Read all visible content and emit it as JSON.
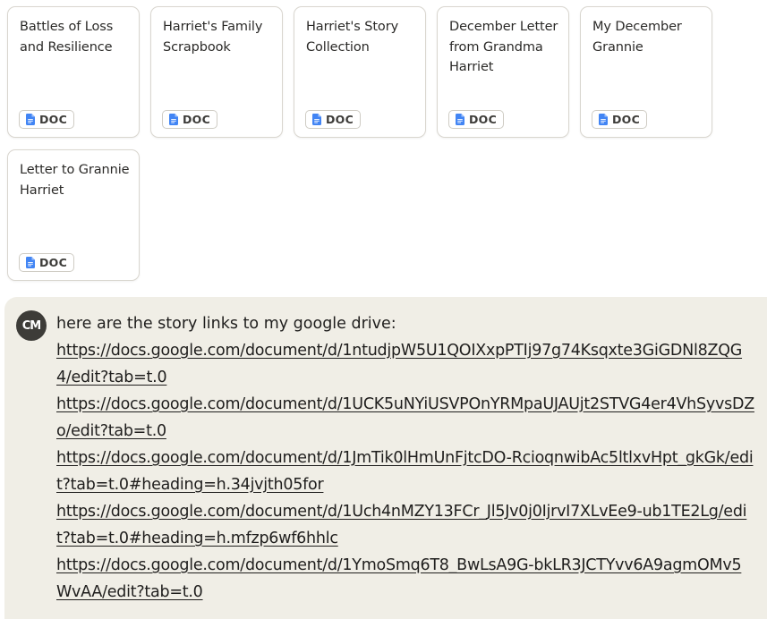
{
  "cards": [
    {
      "title": "Battles of Loss and Resilience",
      "badge": "DOC"
    },
    {
      "title": "Harriet's Family Scrapbook",
      "badge": "DOC"
    },
    {
      "title": "Harriet's Story Collection",
      "badge": "DOC"
    },
    {
      "title": "December Letter from Grandma Harriet",
      "badge": "DOC"
    },
    {
      "title": "My December Grannie",
      "badge": "DOC"
    },
    {
      "title": "Letter to Grannie Harriet",
      "badge": "DOC"
    }
  ],
  "message": {
    "avatar_initials": "CM",
    "intro": "here are the story links to my google drive:",
    "links": [
      "https://docs.google.com/document/d/1ntudjpW5U1QOIXxpPTIj97g74Ksqxte3GiGDNl8ZQG4/edit?tab=t.0",
      "https://docs.google.com/document/d/1UCK5uNYiUSVPOnYRMpaUJAUjt2STVG4er4VhSyvsDZo/edit?tab=t.0",
      "https://docs.google.com/document/d/1JmTik0lHmUnFjtcDO-RcioqnwibAc5ltlxvHpt_gkGk/edit?tab=t.0#heading=h.34jvjth05for",
      "https://docs.google.com/document/d/1Uch4nMZY13FCr_Jl5Jv0j0IjrvI7XLvEe9-ub1TE2Lg/edit?tab=t.0#heading=h.mfzp6wf6hhlc",
      "https://docs.google.com/document/d/1YmoSmq6T8_BwLsA9G-bkLR3JCTYvv6A9agmOMv5WvAA/edit?tab=t.0"
    ]
  },
  "colors": {
    "card_border": "#d9d6cf",
    "message_bg": "#f0eee6",
    "avatar_bg": "#3d3c38",
    "doc_icon": "#4285f4"
  },
  "icons": {
    "doc_badge": "google-docs-icon"
  }
}
